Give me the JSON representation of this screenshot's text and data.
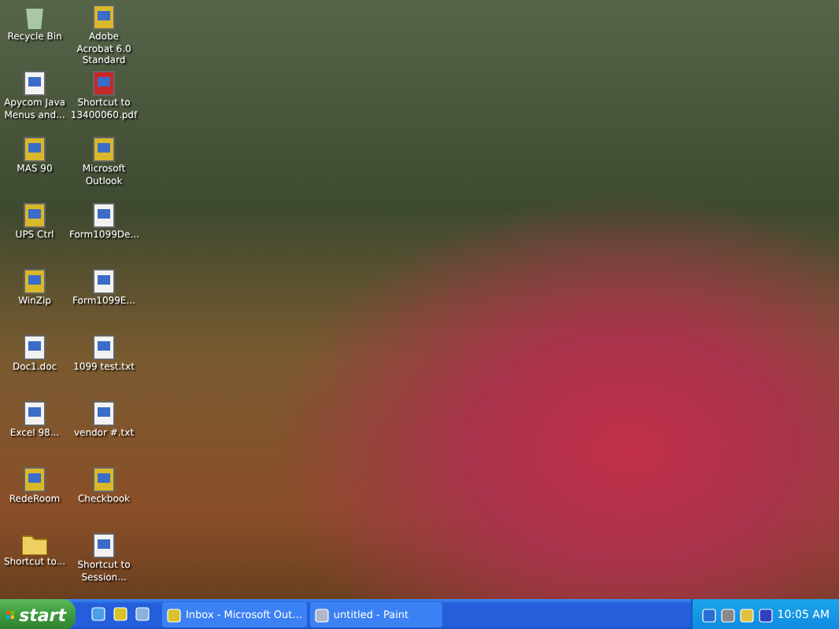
{
  "desktop_icons": [
    {
      "label": "Recycle Bin",
      "kind": "bin"
    },
    {
      "label": "Adobe Acrobat 6.0 Standard",
      "kind": "app"
    },
    {
      "label": "Apycom Java Menus and...",
      "kind": "doc"
    },
    {
      "label": "Shortcut to 13400060.pdf",
      "kind": "pdf"
    },
    {
      "label": "MAS 90",
      "kind": "app"
    },
    {
      "label": "Microsoft Outlook",
      "kind": "app"
    },
    {
      "label": "UPS Ctrl",
      "kind": "app"
    },
    {
      "label": "Form1099De...",
      "kind": "doc"
    },
    {
      "label": "WinZip",
      "kind": "app"
    },
    {
      "label": "Form1099E...",
      "kind": "doc"
    },
    {
      "label": "Doc1.doc",
      "kind": "doc"
    },
    {
      "label": "1099 test.txt",
      "kind": "doc"
    },
    {
      "label": "Excel 98...",
      "kind": "doc"
    },
    {
      "label": "vendor #.txt",
      "kind": "doc"
    },
    {
      "label": "RedeRoom",
      "kind": "app"
    },
    {
      "label": "Checkbook",
      "kind": "app"
    },
    {
      "label": "Shortcut to...",
      "kind": "folder"
    },
    {
      "label": "Shortcut to Session...",
      "kind": "doc"
    }
  ],
  "taskbar": {
    "start": "start",
    "tasks": [
      {
        "label": "Inbox - Microsoft Out..."
      },
      {
        "label": "untitled - Paint"
      }
    ],
    "clock": "10:05 AM"
  }
}
